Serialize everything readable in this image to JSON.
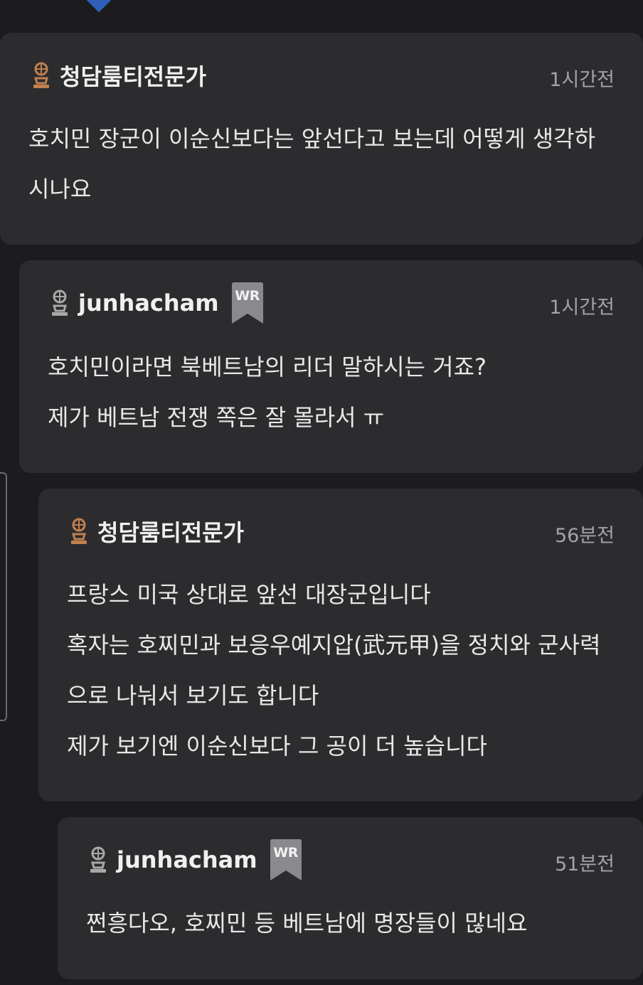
{
  "colors": {
    "background": "#1c1c1e",
    "card": "#2c2c2f",
    "author_icon": "#c08050",
    "reply_icon": "#a8a8a8",
    "badge": "#8a8a8e",
    "accent": "#2f5fb8"
  },
  "comments": [
    {
      "username": "청담룸티전문가",
      "icon": "user-icon-bronze",
      "writer_badge": "",
      "time": "1시간전",
      "lines": [
        "호치민 장군이 이순신보다는 앞선다고 보는데 어떻게 생각하",
        "시나요"
      ]
    },
    {
      "username": "junhacham",
      "icon": "user-icon-gray",
      "writer_badge": "WR",
      "time": "1시간전",
      "lines": [
        "호치민이라면 북베트남의 리더 말하시는 거죠?",
        "제가 베트남 전쟁 쪽은 잘 몰라서 ㅠ"
      ]
    },
    {
      "username": "청담룸티전문가",
      "icon": "user-icon-bronze",
      "writer_badge": "",
      "time": "56분전",
      "lines": [
        "프랑스 미국 상대로 앞선 대장군입니다",
        "혹자는 호찌민과 보응우예지압(武元甲)을 정치와 군사력",
        "으로 나눠서 보기도 합니다",
        "제가 보기엔 이순신보다 그 공이 더 높습니다"
      ]
    },
    {
      "username": "junhacham",
      "icon": "user-icon-gray",
      "writer_badge": "WR",
      "time": "51분전",
      "lines": [
        "쩐흥다오, 호찌민 등 베트남에 명장들이 많네요"
      ]
    }
  ]
}
